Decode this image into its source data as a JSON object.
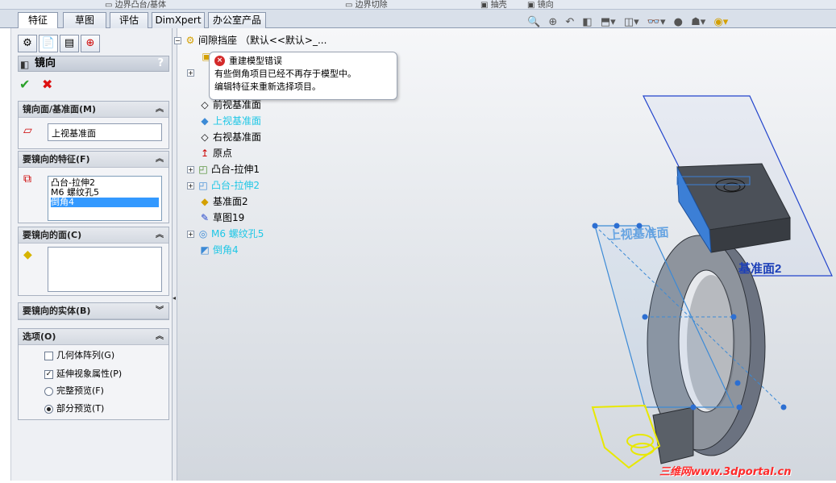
{
  "topbar": {
    "item1": "边界凸台/基体",
    "item2": "边界切除",
    "item3": "抽壳",
    "item4": "镜向"
  },
  "tabs": [
    "特征",
    "草图",
    "评估",
    "DimXpert",
    "办公室产品"
  ],
  "panel": {
    "title": "镜向",
    "help": "?",
    "ok_icon": "✔",
    "cancel_icon": "✖",
    "sections": {
      "plane": {
        "header": "镜向面/基准面(M)",
        "value": "上视基准面"
      },
      "features": {
        "header": "要镜向的特征(F)",
        "items": [
          "凸台-拉伸2",
          "M6 螺纹孔5",
          "倒角4"
        ],
        "selected_index": 2
      },
      "faces": {
        "header": "要镜向的面(C)"
      },
      "bodies": {
        "header": "要镜向的实体(B)"
      },
      "options": {
        "header": "选项(O)",
        "geometry_pattern": {
          "label": "几何体阵列(G)",
          "checked": false
        },
        "propagate_visual": {
          "label": "延伸视象属性(P)",
          "checked": true
        },
        "full_preview": {
          "label": "完整预览(F)",
          "selected": false
        },
        "partial_preview": {
          "label": "部分预览(T)",
          "selected": true
        }
      }
    }
  },
  "tree": {
    "root": "间隙挡座 （默认<<默认>_...",
    "items": [
      "前视基准面",
      "上视基准面",
      "右视基准面",
      "原点",
      "凸台-拉伸1",
      "凸台-拉伸2",
      "基准面2",
      "草图19",
      "M6 螺纹孔5",
      "倒角4"
    ]
  },
  "tooltip": {
    "title": "重建模型错误",
    "line1": "有些倒角项目已经不再存于模型中。",
    "line2": "编辑特征来重新选择项目。"
  },
  "viewport": {
    "plane_top_label": "上视基准面",
    "plane2_label": "基准面2"
  },
  "watermark": "三维网www.3dportal.cn",
  "colors": {
    "highlight": "#1ec7e6",
    "preview": "#e8e800",
    "plane": "#2244cc",
    "selection_blue": "#3399ff"
  }
}
